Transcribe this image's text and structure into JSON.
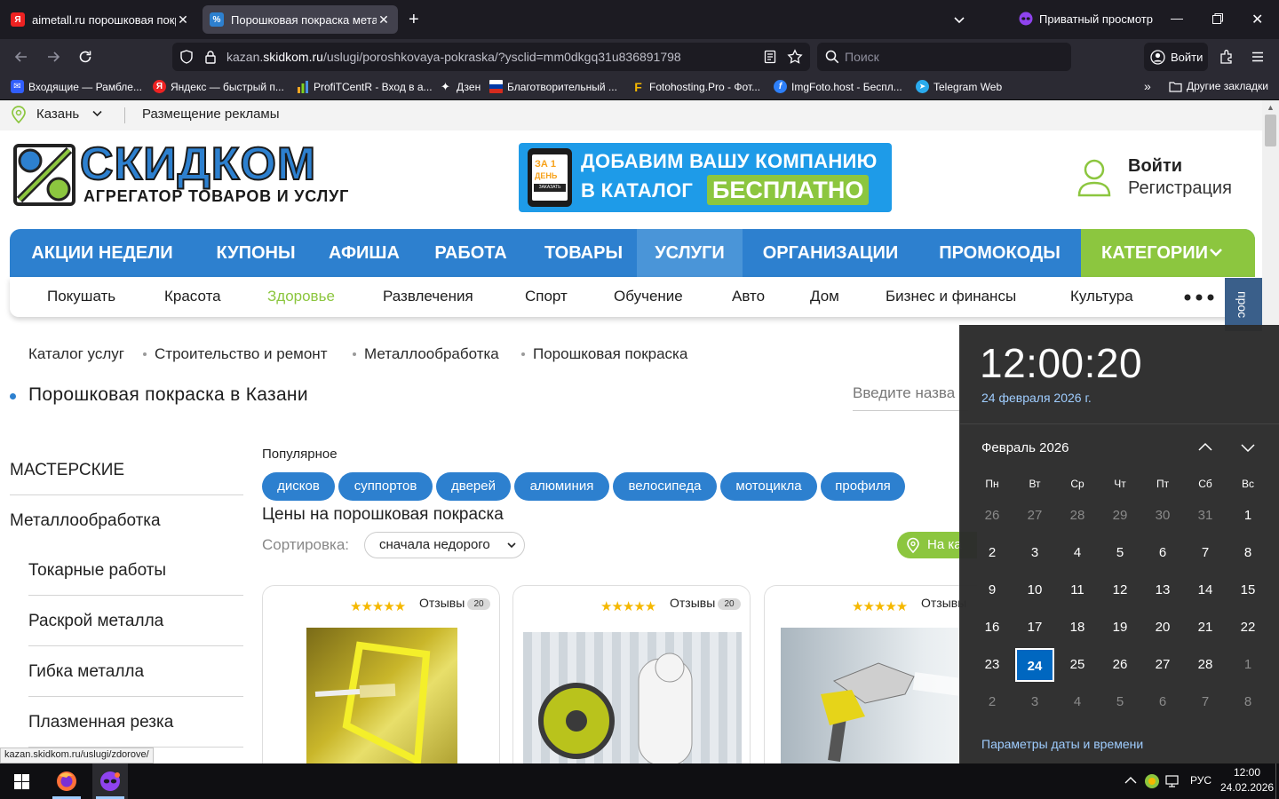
{
  "browser": {
    "tabs": [
      {
        "title": "aimetall.ru порошковая покраска"
      },
      {
        "title": "Порошковая покраска металла"
      }
    ],
    "private_label": "Приватный просмотр",
    "url": {
      "pre": "kazan.",
      "domain": "skidkom.ru",
      "rest": "/uslugi/poroshkovaya-pokraska/?ysclid=mm0dkgq31u836891798"
    },
    "search_placeholder": "Поиск",
    "login_label": "Войти",
    "bookmarks": [
      "Входящие — Рамбле...",
      "Яндекс — быстрый п...",
      "ProfiTCentR - Вход в а...",
      "Дзен",
      "Благотворительный ...",
      "Fotohosting.Pro - Фот...",
      "ImgFoto.host - Беспл...",
      "Telegram Web"
    ],
    "other_bookmarks": "Другие закладки",
    "status_url": "kazan.skidkom.ru/uslugi/zdorove/"
  },
  "site": {
    "city": "Казань",
    "ads_link": "Размещение рекламы",
    "logo_name": "СКИДКОМ",
    "logo_tagline": "АГРЕГАТОР ТОВАРОВ И УСЛУГ",
    "banner_line1": "ДОБАВИМ ВАШУ КОМПАНИЮ",
    "banner_line2": "В КАТАЛОГ",
    "banner_free": "БЕСПЛАТНО",
    "banner_phone_1": "ЗА 1",
    "banner_phone_2": "ДЕНЬ",
    "banner_phone_3": "ЗАКАЗАТЬ",
    "login": "Войти",
    "register": "Регистрация",
    "menu": [
      "АКЦИИ НЕДЕЛИ",
      "КУПОНЫ",
      "АФИША",
      "РАБОТА",
      "ТОВАРЫ",
      "УСЛУГИ",
      "ОРГАНИЗАЦИИ",
      "ПРОМОКОДЫ",
      "КАТЕГОРИИ"
    ],
    "submenu": [
      "Покушать",
      "Красота",
      "Здоровье",
      "Развлечения",
      "Спорт",
      "Обучение",
      "Авто",
      "Дом",
      "Бизнес и финансы",
      "Культура"
    ],
    "side_tab": "прос",
    "breadcrumbs": [
      "Каталог услуг",
      "Строительство и ремонт",
      "Металлообработка",
      "Порошковая покраска"
    ],
    "page_title": "Порошковая покраска в Казани",
    "search_placeholder": "Введите назва",
    "sidebar": {
      "heading": "МАСТЕРСКИЕ",
      "category": "Металлообработка",
      "items": [
        "Токарные работы",
        "Раскрой металла",
        "Гибка металла",
        "Плазменная резка"
      ]
    },
    "popular_label": "Популярное",
    "tags": [
      "дисков",
      "суппортов",
      "дверей",
      "алюминия",
      "велосипеда",
      "мотоцикла",
      "профиля"
    ],
    "prices_title": "Цены на порошковая покраска",
    "sort_label": "Сортировка:",
    "sort_value": "сначала недорого",
    "map_button": "На ка",
    "cards": [
      {
        "rating": 5,
        "reviews_label": "Отзывы",
        "reviews_count": "20"
      },
      {
        "rating": 5,
        "reviews_label": "Отзывы",
        "reviews_count": "20"
      },
      {
        "rating": 5,
        "reviews_label": "Отзывы"
      }
    ]
  },
  "calendar": {
    "time": "12:00:20",
    "date": "24 февраля 2026 г.",
    "month": "Февраль 2026",
    "weekdays": [
      "Пн",
      "Вт",
      "Ср",
      "Чт",
      "Пт",
      "Сб",
      "Вс"
    ],
    "rows": [
      [
        "26",
        "27",
        "28",
        "29",
        "30",
        "31",
        "1"
      ],
      [
        "2",
        "3",
        "4",
        "5",
        "6",
        "7",
        "8"
      ],
      [
        "9",
        "10",
        "11",
        "12",
        "13",
        "14",
        "15"
      ],
      [
        "16",
        "17",
        "18",
        "19",
        "20",
        "21",
        "22"
      ],
      [
        "23",
        "24",
        "25",
        "26",
        "27",
        "28",
        "1"
      ],
      [
        "2",
        "3",
        "4",
        "5",
        "6",
        "7",
        "8"
      ]
    ],
    "dim_cells": [
      [
        0,
        0
      ],
      [
        0,
        1
      ],
      [
        0,
        2
      ],
      [
        0,
        3
      ],
      [
        0,
        4
      ],
      [
        0,
        5
      ],
      [
        4,
        6
      ],
      [
        5,
        0
      ],
      [
        5,
        1
      ],
      [
        5,
        2
      ],
      [
        5,
        3
      ],
      [
        5,
        4
      ],
      [
        5,
        5
      ],
      [
        5,
        6
      ]
    ],
    "today_cell": [
      4,
      1
    ],
    "settings_link": "Параметры даты и времени"
  },
  "taskbar": {
    "lang": "РУС",
    "time": "12:00",
    "date": "24.02.2026"
  },
  "colors": {
    "brand_blue": "#2d80cf",
    "brand_green": "#8cc63f",
    "active_menu": "#4a95d8",
    "calendar_accent": "#0067c0"
  }
}
